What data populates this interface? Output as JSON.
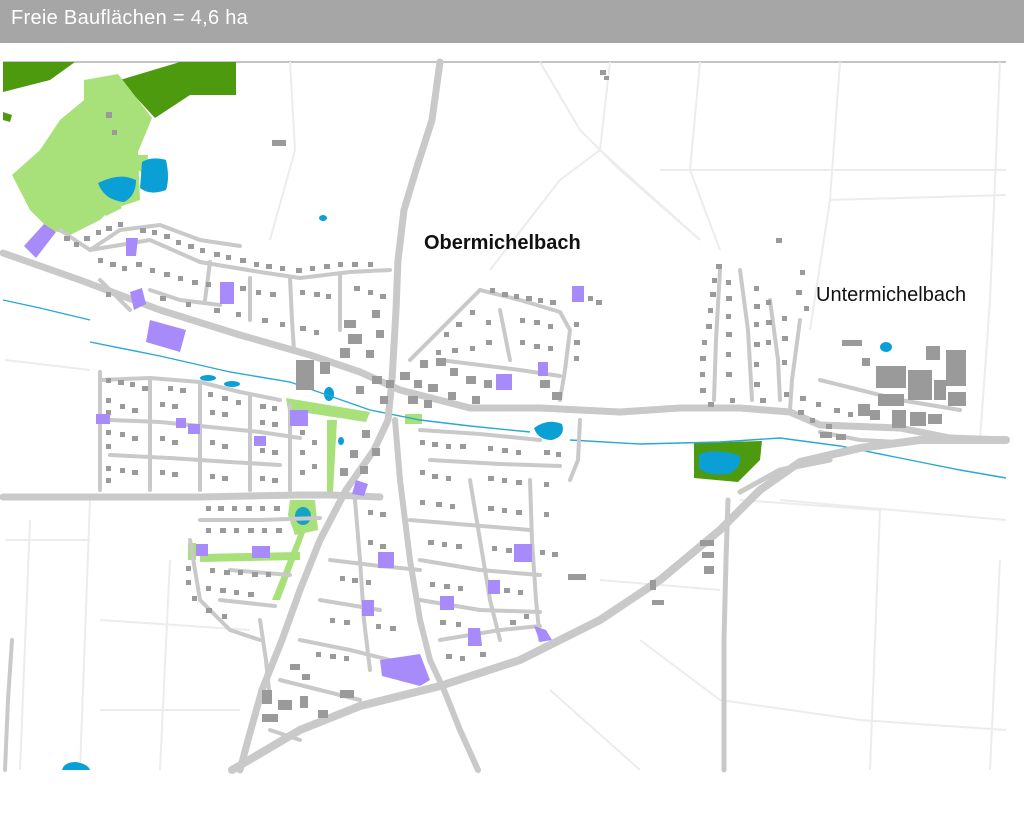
{
  "header": {
    "title": "Freie Bauflächen = 4,6 ha"
  },
  "map": {
    "labels": {
      "obermichelbach": "Obermichelbach",
      "untermichelbach": "Untermichelbach"
    },
    "colors": {
      "road": "#c9c9c9",
      "field_line": "#eeeeee",
      "building": "#9a9a9a",
      "free_plot": "#a78bfa",
      "meadow": "#a8e07a",
      "forest": "#4e9a0e",
      "water": "#0aa0d6",
      "stream": "#2aa7d6"
    },
    "legend_meaning": {
      "free_plot": "Freie Bauflächen"
    }
  }
}
